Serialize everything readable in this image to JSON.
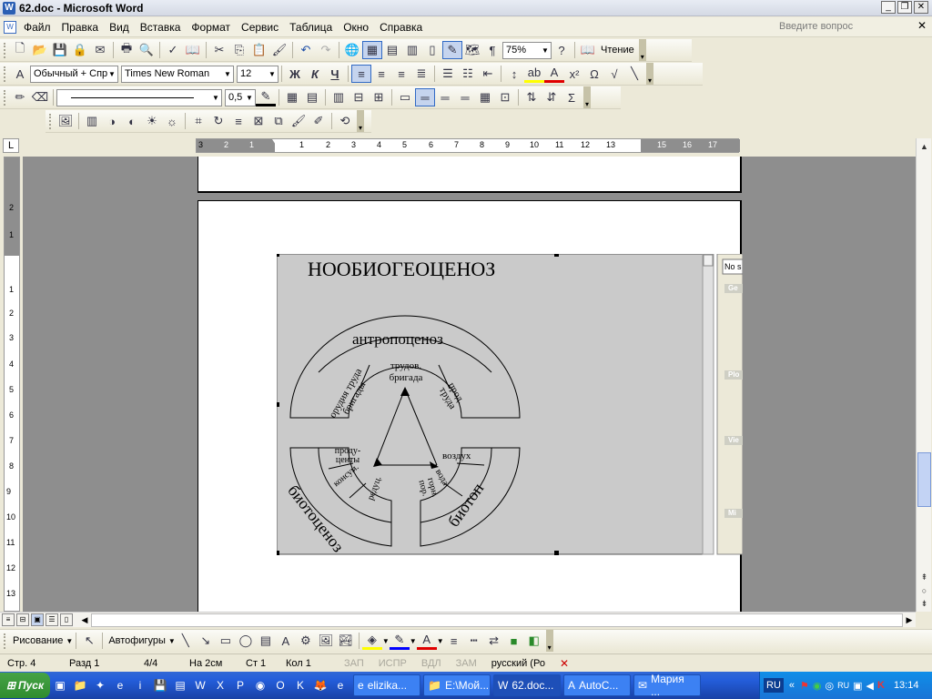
{
  "window": {
    "title": "62.doc - Microsoft Word",
    "app_icon": "W"
  },
  "window_buttons": [
    "_",
    "❐",
    "✕"
  ],
  "menu": {
    "items": [
      "Файл",
      "Правка",
      "Вид",
      "Вставка",
      "Формат",
      "Сервис",
      "Таблица",
      "Окно",
      "Справка"
    ],
    "help_placeholder": "Введите вопрос"
  },
  "standard_toolbar": {
    "zoom": "75%",
    "reading_label": "Чтение"
  },
  "formatting_toolbar": {
    "style": "Обычный + Спр",
    "font": "Times New Roman",
    "size": "12",
    "bold": "Ж",
    "italic": "К",
    "underline": "Ч"
  },
  "table_toolbar": {
    "line_weight": "0,5"
  },
  "ruler": {
    "labels": [
      "3",
      "2",
      "1",
      "1",
      "2",
      "3",
      "4",
      "5",
      "6",
      "7",
      "8",
      "9",
      "10",
      "11",
      "12",
      "13",
      "15",
      "16",
      "17"
    ],
    "vertical_labels": [
      "2",
      "1",
      "1",
      "2",
      "3",
      "4",
      "5",
      "6",
      "7",
      "8",
      "9",
      "10",
      "11",
      "12",
      "13"
    ],
    "corner": "L"
  },
  "diagram": {
    "title": "НООБИОГЕОЦЕНОЗ",
    "top_arc": "антропоценоз",
    "top_segments": [
      "орудия труда бригады",
      "трудов. бригада",
      "прод. труда"
    ],
    "left_arc": "биотоценоз",
    "left_segments": [
      "проду-центы",
      "консум.",
      "редуц."
    ],
    "right_arc": "биотоп",
    "right_segments": [
      "воздух",
      "вода",
      "горн. пор."
    ]
  },
  "side_panel": {
    "input": "No s",
    "sections": [
      "Ge",
      "Plo",
      "Vie",
      "Mi"
    ]
  },
  "drawing_toolbar": {
    "drawing_label": "Рисование",
    "autoshapes_label": "Автофигуры"
  },
  "status": {
    "page": "Стр. 4",
    "section": "Разд 1",
    "page_of": "4/4",
    "at": "На 2см",
    "line": "Ст 1",
    "column": "Кол 1",
    "rec": "ЗАП",
    "trk": "ИСПР",
    "ext": "ВДЛ",
    "ovr": "ЗАМ",
    "language": "русский (Ро"
  },
  "taskbar": {
    "start": "Пуск",
    "tasks": [
      "elizika...",
      "E:\\Мой...",
      "62.doc...",
      "AutoC...",
      "Мария ..."
    ],
    "lang": "RU",
    "tray_lang": "RU",
    "clock": "13:14"
  },
  "colors": {
    "workspace": "#8e8e8e",
    "diagram_bg": "#cacaca",
    "taskbar": "#245edb",
    "start": "#3c9a3c"
  }
}
